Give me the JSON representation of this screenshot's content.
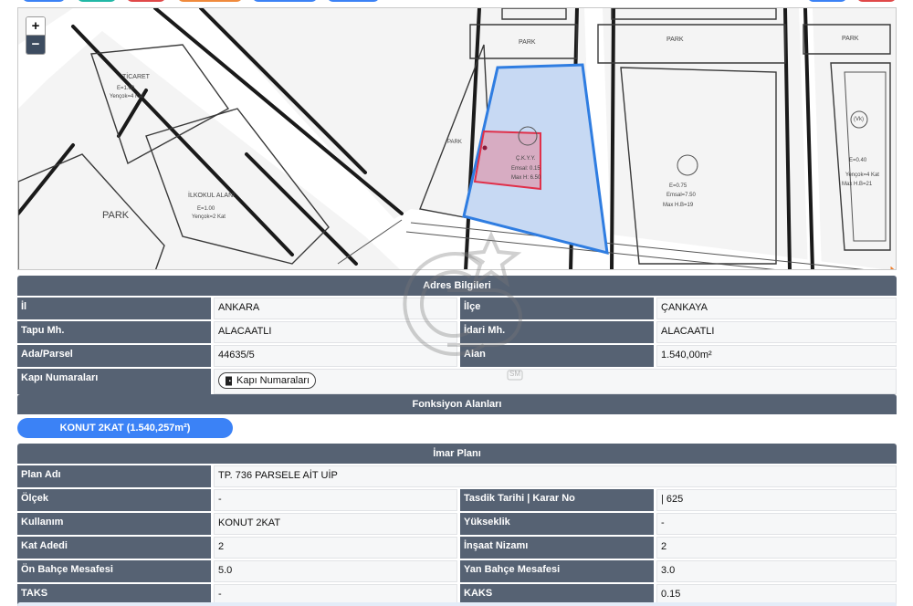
{
  "map": {
    "zoom_in": "+",
    "zoom_out": "−",
    "labels": {
      "park1": "PARK",
      "park2": "PARK",
      "park3": "PARK",
      "park4": "PARK",
      "park5": "PARK",
      "ticaret": "TİCARET",
      "ilkokul": "İLKOKUL ALANI",
      "vekil": "(Vk)"
    },
    "parcel_fill": "#c7d9f3",
    "parcel_stroke": "#2f7de1",
    "selected_fill": "#d9a3b8",
    "selected_stroke": "#e0304a"
  },
  "adres": {
    "title": "Adres Bilgileri",
    "il_label": "İl",
    "il_value": "ANKARA",
    "ilce_label": "İlçe",
    "ilce_value": "ÇANKAYA",
    "tapu_label": "Tapu Mh.",
    "tapu_value": "ALACAATLI",
    "idari_label": "İdari Mh.",
    "idari_value": "ALACAATLI",
    "ada_label": "Ada/Parsel",
    "ada_value": "44635/5",
    "alan_label": "Alan",
    "alan_value": "1.540,00m²",
    "kapi_label": "Kapı Numaraları",
    "kapi_button": "Kapı Numaraları"
  },
  "fonksiyon": {
    "title": "Fonksiyon Alanları",
    "pill": "KONUT 2KAT (1.540,257m²)"
  },
  "imar": {
    "title": "İmar Planı",
    "plan_adi_label": "Plan Adı",
    "plan_adi_value": "TP. 736 PARSELE AİT UİP",
    "olcek_label": "Ölçek",
    "olcek_value": "-",
    "tasdik_label": "Tasdik Tarihi | Karar No",
    "tasdik_value": "| 625",
    "kullanim_label": "Kullanım",
    "kullanim_value": "KONUT 2KAT",
    "yukseklik_label": "Yükseklik",
    "yukseklik_value": "-",
    "kat_label": "Kat Adedi",
    "kat_value": "2",
    "nizam_label": "İnşaat Nizamı",
    "nizam_value": "2",
    "on_label": "Ön Bahçe Mesafesi",
    "on_value": "5.0",
    "yan_label": "Yan Bahçe Mesafesi",
    "yan_value": "3.0",
    "taks_label": "TAKS",
    "taks_value": "-",
    "kaks_label": "KAKS",
    "kaks_value": "0.15"
  },
  "watermark_text": "SM"
}
